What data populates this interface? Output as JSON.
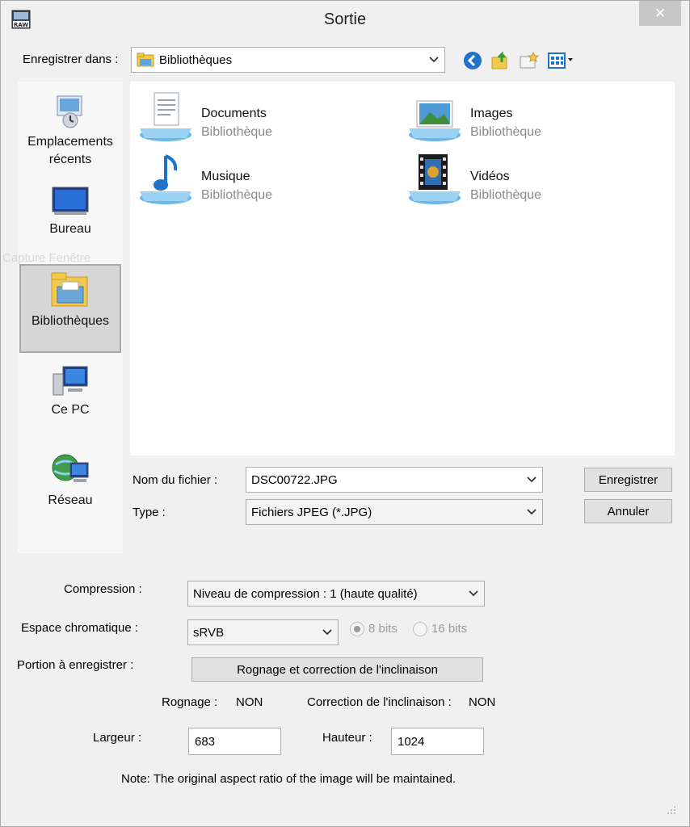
{
  "window": {
    "title": "Sortie",
    "close_label": "✕",
    "app_icon_text": "RAW"
  },
  "toolbar": {
    "save_in_label": "Enregistrer dans :",
    "save_in_value": "Bibliothèques"
  },
  "places": [
    {
      "line1": "Emplacements",
      "line2": "récents",
      "icon": "recent-places-icon"
    },
    {
      "line1": "Bureau",
      "icon": "desktop-icon"
    },
    {
      "line1": "Bibliothèques",
      "icon": "libraries-icon",
      "selected": true
    },
    {
      "line1": "Ce PC",
      "icon": "computer-icon"
    },
    {
      "line1": "Réseau",
      "icon": "network-icon"
    }
  ],
  "ghost_text": "Capture Fenêtre",
  "libraries": [
    {
      "name": "Documents",
      "type": "Bibliothèque",
      "icon": "documents-library-icon"
    },
    {
      "name": "Images",
      "type": "Bibliothèque",
      "icon": "pictures-library-icon"
    },
    {
      "name": "Musique",
      "type": "Bibliothèque",
      "icon": "music-library-icon"
    },
    {
      "name": "Vidéos",
      "type": "Bibliothèque",
      "icon": "videos-library-icon"
    }
  ],
  "file": {
    "name_label": "Nom du fichier :",
    "name_value": "DSC00722.JPG",
    "type_label": "Type :",
    "type_value": "Fichiers JPEG (*.JPG)",
    "save_button": "Enregistrer",
    "cancel_button": "Annuler"
  },
  "options": {
    "compression_label": "Compression :",
    "compression_value": "Niveau de compression : 1 (haute qualité)",
    "colorspace_label": "Espace chromatique :",
    "colorspace_value": "sRVB",
    "bits8_label": "8 bits",
    "bits16_label": "16 bits",
    "portion_label": "Portion à enregistrer :",
    "crop_button": "Rognage et correction de l'inclinaison",
    "crop_label": "Rognage :",
    "crop_value": "NON",
    "tilt_label": "Correction de l'inclinaison :",
    "tilt_value": "NON",
    "width_label": "Largeur :",
    "width_value": "683",
    "height_label": "Hauteur :",
    "height_value": "1024",
    "note": "Note: The original aspect ratio of the image will be maintained."
  },
  "colors": {
    "accent": "#1e73c8",
    "folder": "#f2c94c",
    "selected_place": "#d6d6d6"
  }
}
